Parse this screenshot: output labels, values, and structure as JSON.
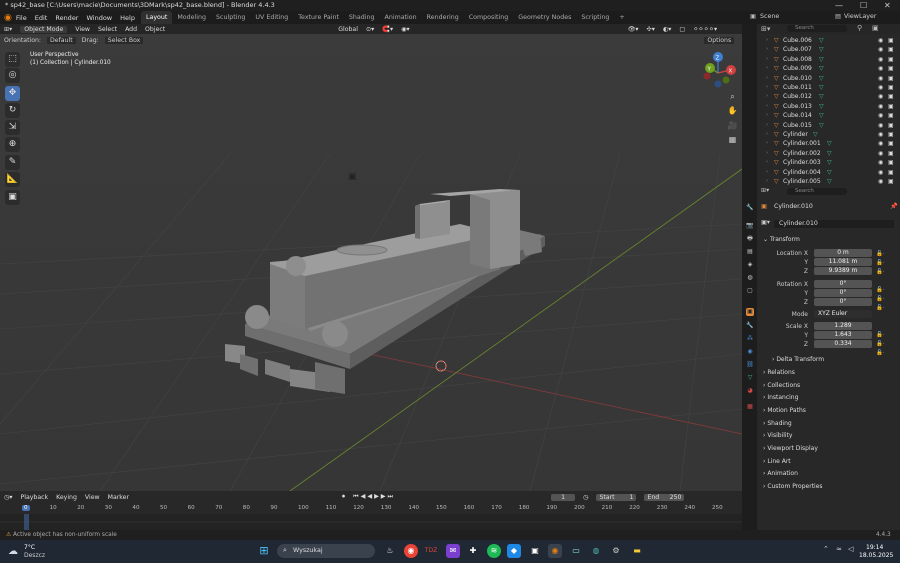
{
  "window": {
    "title": "* sp42_base [C:\\Users\\macie\\Documents\\3DMark\\sp42_base.blend] - Blender 4.4.3",
    "min": "—",
    "max": "☐",
    "close": "✕"
  },
  "menu": [
    "File",
    "Edit",
    "Render",
    "Window",
    "Help"
  ],
  "workspaces": [
    "Layout",
    "Modeling",
    "Sculpting",
    "UV Editing",
    "Texture Paint",
    "Shading",
    "Animation",
    "Rendering",
    "Compositing",
    "Geometry Nodes",
    "Scripting",
    "+"
  ],
  "scene": {
    "label": "Scene",
    "view_layer": "ViewLayer"
  },
  "viewport_header": {
    "mode": "Object Mode",
    "items": [
      "View",
      "Select",
      "Add",
      "Object"
    ],
    "orientation": "Global",
    "options": "Options"
  },
  "viewport_header2": {
    "orientation_label": "Orientation:",
    "orientation_value": "Default",
    "drag_label": "Drag:",
    "drag_value": "Select Box"
  },
  "viewport_overlay": {
    "perspective": "User Perspective",
    "collection": "(1) Collection | Cylinder.010"
  },
  "gizmo": {
    "x": "X",
    "y": "Y",
    "z": "Z"
  },
  "outliner": {
    "search_placeholder": "Search",
    "items": [
      "Cube.006",
      "Cube.007",
      "Cube.008",
      "Cube.009",
      "Cube.010",
      "Cube.011",
      "Cube.012",
      "Cube.013",
      "Cube.014",
      "Cube.015",
      "Cylinder",
      "Cylinder.001",
      "Cylinder.002",
      "Cylinder.003",
      "Cylinder.004",
      "Cylinder.005"
    ]
  },
  "properties": {
    "search_placeholder": "Search",
    "object_name": "Cylinder.010",
    "object_field": "Cylinder.010",
    "transform": {
      "title": "Transform",
      "location": {
        "label": "Location X",
        "y": "Y",
        "z": "Z",
        "x_val": "0 m",
        "y_val": "11.081 m",
        "z_val": "9.9389 m"
      },
      "rotation": {
        "label": "Rotation X",
        "y": "Y",
        "z": "Z",
        "x_val": "0°",
        "y_val": "0°",
        "z_val": "0°"
      },
      "mode": {
        "label": "Mode",
        "value": "XYZ Euler"
      },
      "scale": {
        "label": "Scale X",
        "y": "Y",
        "z": "Z",
        "x_val": "1.289",
        "y_val": "1.643",
        "z_val": "0.334"
      },
      "delta": "Delta Transform"
    },
    "sections": [
      "Relations",
      "Collections",
      "Instancing",
      "Motion Paths",
      "Shading",
      "Visibility",
      "Viewport Display",
      "Line Art",
      "Animation",
      "Custom Properties"
    ]
  },
  "timeline": {
    "items": [
      "Playback",
      "Keying",
      "View",
      "Marker"
    ],
    "current_frame": "1",
    "start_label": "Start",
    "start": "1",
    "end_label": "End",
    "end": "250",
    "ticks": [
      "0",
      "10",
      "20",
      "30",
      "40",
      "50",
      "60",
      "70",
      "80",
      "90",
      "100",
      "110",
      "120",
      "130",
      "140",
      "150",
      "160",
      "170",
      "180",
      "190",
      "200",
      "210",
      "220",
      "230",
      "240",
      "250"
    ]
  },
  "status": {
    "message": "Active object has non-uniform scale",
    "version": "4.4.3"
  },
  "taskbar": {
    "weather_temp": "7°C",
    "weather_desc": "Deszcz",
    "search_placeholder": "Wyszukaj",
    "time": "19:14",
    "date": "18.05.2025"
  }
}
